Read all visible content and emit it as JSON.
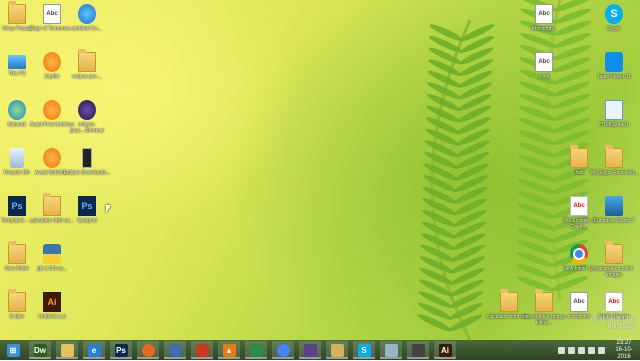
{
  "desktop": {
    "icons_left": [
      {
        "label": "Vinay Prasad",
        "type": "folder"
      },
      {
        "label": "Edge of Tomorrow...",
        "type": "doc"
      },
      {
        "label": "Untitled Co...",
        "type": "ie"
      },
      {
        "label": "This PC",
        "type": "pc"
      },
      {
        "label": "Zapfile",
        "type": "orange"
      },
      {
        "label": "eclipse-jee-...",
        "type": "folder"
      },
      {
        "label": "Network",
        "type": "net"
      },
      {
        "label": "Avast Free Antivirus",
        "type": "orange"
      },
      {
        "label": "eclipse-java-...Shortcut",
        "type": "purple"
      },
      {
        "label": "Recycle Bin",
        "type": "recycle"
      },
      {
        "label": "Avast SafeZo...",
        "type": "orange"
      },
      {
        "label": "Eclipse Downloads...",
        "type": "phone"
      },
      {
        "label": "Template1 - ...",
        "type": "ps"
      },
      {
        "label": "calculator html ve...",
        "type": "folder"
      },
      {
        "label": "Ezsignal",
        "type": "ps"
      },
      {
        "label": "New folder",
        "type": "folder"
      },
      {
        "label": "jdk 1.6.0 ca...",
        "type": "py"
      },
      {
        "label": "8 slice",
        "type": "folder"
      },
      {
        "label": "Untitled-1.ai",
        "type": "ai"
      }
    ],
    "icons_right": [
      {
        "label": "Skype",
        "type": "skype"
      },
      {
        "label": "Abcdefghi..",
        "type": "doc"
      },
      {
        "label": "TeamViewer 11",
        "type": "tv"
      },
      {
        "label": ".cool",
        "type": "doc"
      },
      {
        "label": "HTMLSheet1",
        "type": "blue-doc"
      },
      {
        "label": "Jadi",
        "type": "folder"
      },
      {
        "label": "My Skype Received...",
        "type": "folder"
      },
      {
        "label": "The Ecstatic of Creati...",
        "type": "pdf"
      },
      {
        "label": "Camtasia Studio 7",
        "type": "cam"
      },
      {
        "label": "New folder (2)",
        "type": "chrome"
      },
      {
        "label": "transparent color images",
        "type": "folder"
      },
      {
        "label": "calculator html ver...",
        "type": "folder"
      },
      {
        "label": "new sidebar popup inline...",
        "type": "folder"
      },
      {
        "label": "emoticons",
        "type": "doc"
      },
      {
        "label": "Adobe Reader",
        "type": "pdf"
      }
    ],
    "watermark": {
      "line1": "Windows 8.1 Pro",
      "line2": "Build 9600"
    }
  },
  "taskbar": {
    "apps": [
      {
        "name": "start-button",
        "glyph": "⊞",
        "color": "#3a8fd8"
      },
      {
        "name": "dreamweaver",
        "glyph": "Dw",
        "color": "#2f5c1e"
      },
      {
        "name": "file-explorer",
        "glyph": "",
        "color": "#e6c15a"
      },
      {
        "name": "internet-explorer",
        "glyph": "e",
        "color": "#2a7fd6"
      },
      {
        "name": "photoshop",
        "glyph": "Ps",
        "color": "#0b2850"
      },
      {
        "name": "firefox",
        "glyph": "",
        "color": "#e66a1d"
      },
      {
        "name": "network",
        "glyph": "",
        "color": "#3c6fb5"
      },
      {
        "name": "app-red",
        "glyph": "",
        "color": "#c63a22"
      },
      {
        "name": "vlc",
        "glyph": "▲",
        "color": "#e87a10"
      },
      {
        "name": "app-green",
        "glyph": "",
        "color": "#2d8c47"
      },
      {
        "name": "chrome",
        "glyph": "",
        "color": "#4285f4"
      },
      {
        "name": "media",
        "glyph": "",
        "color": "#5a3f8c"
      },
      {
        "name": "folder",
        "glyph": "",
        "color": "#d7b25a"
      },
      {
        "name": "skype",
        "glyph": "S",
        "color": "#00aff0"
      },
      {
        "name": "notepad",
        "glyph": "",
        "color": "#9ab5c8"
      },
      {
        "name": "tv",
        "glyph": "",
        "color": "#444"
      },
      {
        "name": "illustrator",
        "glyph": "Ai",
        "color": "#3b1a00"
      }
    ],
    "clock": {
      "time": "23:27",
      "date": "16-10-2016"
    }
  }
}
